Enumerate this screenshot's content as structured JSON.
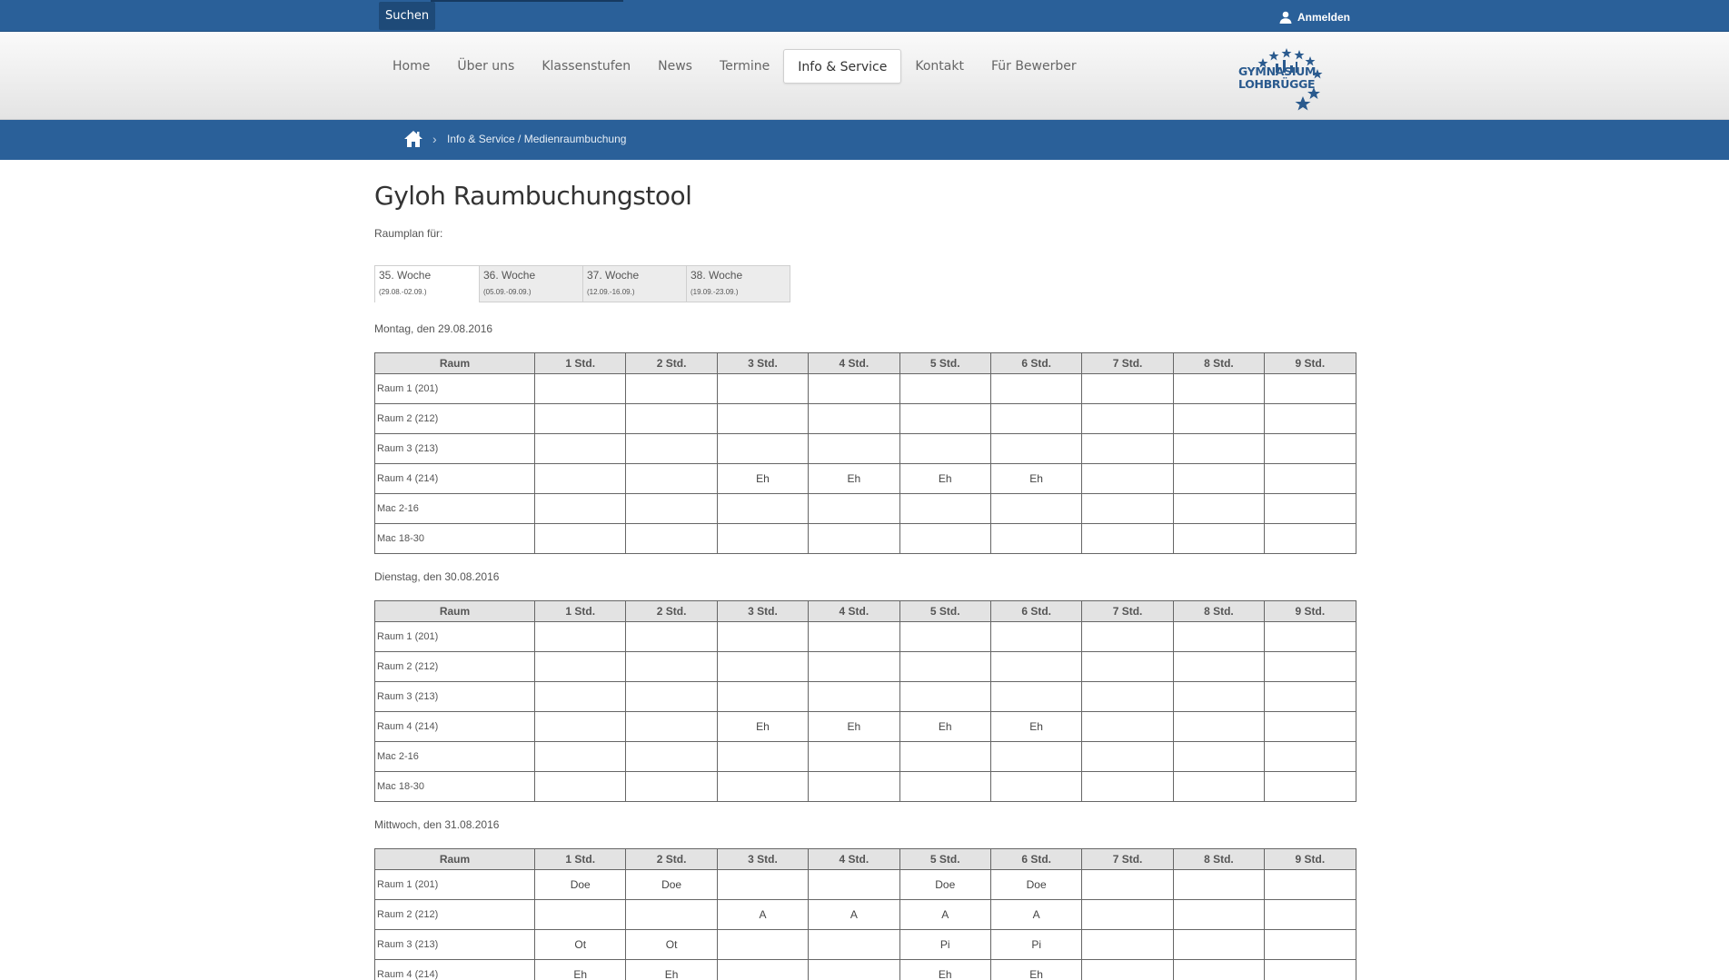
{
  "topbar": {
    "search_label": "Suchen",
    "login_label": "Anmelden"
  },
  "nav": {
    "items": [
      "Home",
      "Über uns",
      "Klassenstufen",
      "News",
      "Termine",
      "Info & Service",
      "Kontakt",
      "Für Bewerber"
    ],
    "active": "Info & Service"
  },
  "logo": {
    "line1": "GYMNASIUM",
    "line2": "LOHBRÜGGE"
  },
  "breadcrumb": {
    "path": "Info & Service / Medienraumbuchung"
  },
  "page": {
    "title": "Gyloh Raumbuchungstool",
    "subtitle": "Raumplan für:"
  },
  "weeks": [
    {
      "label": "35. Woche",
      "range": "(29.08.-02.09.)"
    },
    {
      "label": "36. Woche",
      "range": "(05.09.-09.09.)"
    },
    {
      "label": "37. Woche",
      "range": "(12.09.-16.09.)"
    },
    {
      "label": "38. Woche",
      "range": "(19.09.-23.09.)"
    }
  ],
  "table_headers": [
    "Raum",
    "1 Std.",
    "2 Std.",
    "3 Std.",
    "4 Std.",
    "5 Std.",
    "6 Std.",
    "7 Std.",
    "8 Std.",
    "9 Std."
  ],
  "days": [
    {
      "label": "Montag, den 29.08.2016",
      "rows": [
        [
          "Raum 1 (201)",
          "",
          "",
          "",
          "",
          "",
          "",
          "",
          "",
          ""
        ],
        [
          "Raum 2 (212)",
          "",
          "",
          "",
          "",
          "",
          "",
          "",
          "",
          ""
        ],
        [
          "Raum 3 (213)",
          "",
          "",
          "",
          "",
          "",
          "",
          "",
          "",
          ""
        ],
        [
          "Raum 4 (214)",
          "",
          "",
          "Eh",
          "Eh",
          "Eh",
          "Eh",
          "",
          "",
          ""
        ],
        [
          "Mac 2-16",
          "",
          "",
          "",
          "",
          "",
          "",
          "",
          "",
          ""
        ],
        [
          "Mac 18-30",
          "",
          "",
          "",
          "",
          "",
          "",
          "",
          "",
          ""
        ]
      ]
    },
    {
      "label": "Dienstag, den 30.08.2016",
      "rows": [
        [
          "Raum 1 (201)",
          "",
          "",
          "",
          "",
          "",
          "",
          "",
          "",
          ""
        ],
        [
          "Raum 2 (212)",
          "",
          "",
          "",
          "",
          "",
          "",
          "",
          "",
          ""
        ],
        [
          "Raum 3 (213)",
          "",
          "",
          "",
          "",
          "",
          "",
          "",
          "",
          ""
        ],
        [
          "Raum 4 (214)",
          "",
          "",
          "Eh",
          "Eh",
          "Eh",
          "Eh",
          "",
          "",
          ""
        ],
        [
          "Mac 2-16",
          "",
          "",
          "",
          "",
          "",
          "",
          "",
          "",
          ""
        ],
        [
          "Mac 18-30",
          "",
          "",
          "",
          "",
          "",
          "",
          "",
          "",
          ""
        ]
      ]
    },
    {
      "label": "Mittwoch, den 31.08.2016",
      "rows": [
        [
          "Raum 1 (201)",
          "Doe",
          "Doe",
          "",
          "",
          "Doe",
          "Doe",
          "",
          "",
          ""
        ],
        [
          "Raum 2 (212)",
          "",
          "",
          "A",
          "A",
          "A",
          "A",
          "",
          "",
          ""
        ],
        [
          "Raum 3 (213)",
          "Ot",
          "Ot",
          "",
          "",
          "Pi",
          "Pi",
          "",
          "",
          ""
        ],
        [
          "Raum 4 (214)",
          "Eh",
          "Eh",
          "",
          "",
          "Eh",
          "Eh",
          "",
          "",
          ""
        ]
      ]
    }
  ]
}
